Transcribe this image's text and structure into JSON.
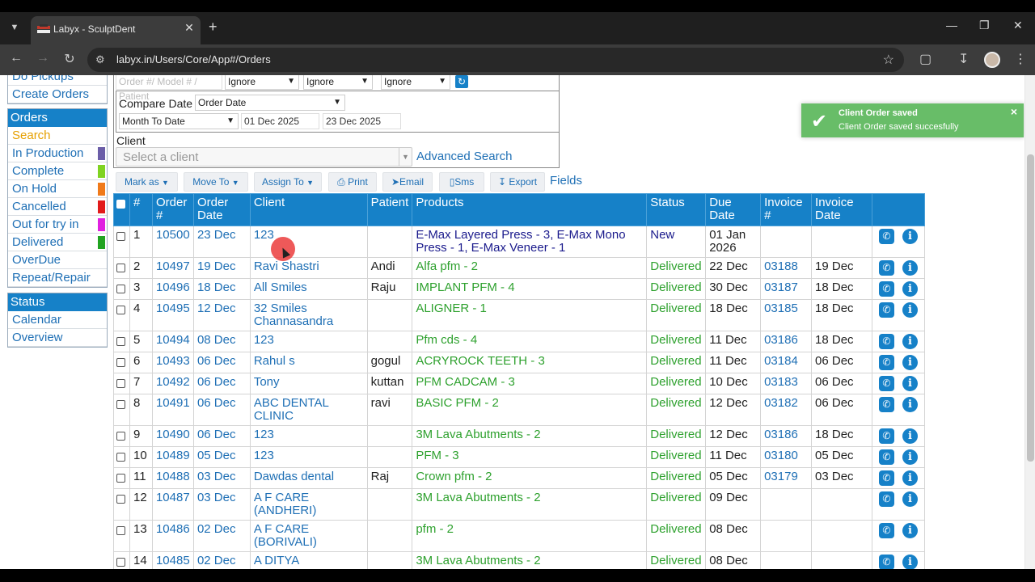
{
  "browser": {
    "tab_title": "Labyx - SculptDent",
    "url": "labyx.in/Users/Core/App#/Orders"
  },
  "menu": {
    "partial_top": "Do Pickups",
    "create_orders": "Create Orders",
    "orders_head": "Orders",
    "items": [
      {
        "label": "Search",
        "color": ""
      },
      {
        "label": "In Production",
        "color": "#6b5ea8"
      },
      {
        "label": "Complete",
        "color": "#7fd321"
      },
      {
        "label": "On Hold",
        "color": "#f07a1a"
      },
      {
        "label": "Cancelled",
        "color": "#e21b1b"
      },
      {
        "label": "Out for try in",
        "color": "#e020e0"
      },
      {
        "label": "Delivered",
        "color": "#21a321"
      },
      {
        "label": "OverDue",
        "color": ""
      },
      {
        "label": "Repeat/Repair",
        "color": ""
      }
    ],
    "status_head": "Status",
    "status_items": [
      "Calendar",
      "Overview"
    ]
  },
  "filters": {
    "search_placeholder": "Order #/ Model # / Patient",
    "ignore1": "Ignore",
    "ignore2": "Ignore",
    "ignore3": "Ignore",
    "compare_label": "Compare Date",
    "compare_value": "Order Date",
    "range_value": "Month To Date",
    "from_date": "01 Dec 2025",
    "to_date": "23 Dec 2025",
    "client_label": "Client",
    "client_placeholder": "Select a client",
    "advanced_search": "Advanced Search"
  },
  "actions": {
    "mark_as": "Mark as",
    "move_to": "Move To",
    "assign_to": "Assign To",
    "print": "Print",
    "email": "Email",
    "sms": "Sms",
    "export": "Export",
    "fields": "Fields"
  },
  "table": {
    "headers": [
      "#",
      "Order #",
      "Order Date",
      "Client",
      "Patient",
      "Products",
      "Status",
      "Due Date",
      "Invoice #",
      "Invoice Date"
    ],
    "rows": [
      {
        "n": "1",
        "order": "10500",
        "date": "23 Dec",
        "client": "123",
        "patient": "",
        "products": "E-Max Layered Press - 3, E-Max Mono Press - 1, E-Max Veneer - 1",
        "status": "New",
        "due": "01 Jan 2026",
        "invoice": "",
        "inv_date": ""
      },
      {
        "n": "2",
        "order": "10497",
        "date": "19 Dec",
        "client": "Ravi Shastri",
        "patient": "Andi",
        "products": "Alfa pfm - 2",
        "status": "Delivered",
        "due": "22 Dec",
        "invoice": "03188",
        "inv_date": "19 Dec"
      },
      {
        "n": "3",
        "order": "10496",
        "date": "18 Dec",
        "client": "All Smiles",
        "patient": "Raju",
        "products": "IMPLANT PFM - 4",
        "status": "Delivered",
        "due": "30 Dec",
        "invoice": "03187",
        "inv_date": "18 Dec"
      },
      {
        "n": "4",
        "order": "10495",
        "date": "12 Dec",
        "client": "32 Smiles Channasandra",
        "patient": "",
        "products": "ALIGNER - 1",
        "status": "Delivered",
        "due": "18 Dec",
        "invoice": "03185",
        "inv_date": "18 Dec"
      },
      {
        "n": "5",
        "order": "10494",
        "date": "08 Dec",
        "client": "123",
        "patient": "",
        "products": "Pfm cds - 4",
        "status": "Delivered",
        "due": "11 Dec",
        "invoice": "03186",
        "inv_date": "18 Dec"
      },
      {
        "n": "6",
        "order": "10493",
        "date": "06 Dec",
        "client": "Rahul s",
        "patient": "gogul",
        "products": "ACRYROCK TEETH - 3",
        "status": "Delivered",
        "due": "11 Dec",
        "invoice": "03184",
        "inv_date": "06 Dec"
      },
      {
        "n": "7",
        "order": "10492",
        "date": "06 Dec",
        "client": "Tony",
        "patient": "kuttan",
        "products": "PFM CADCAM - 3",
        "status": "Delivered",
        "due": "10 Dec",
        "invoice": "03183",
        "inv_date": "06 Dec"
      },
      {
        "n": "8",
        "order": "10491",
        "date": "06 Dec",
        "client": "ABC DENTAL CLINIC",
        "patient": "ravi",
        "products": "BASIC PFM - 2",
        "status": "Delivered",
        "due": "12 Dec",
        "invoice": "03182",
        "inv_date": "06 Dec"
      },
      {
        "n": "9",
        "order": "10490",
        "date": "06 Dec",
        "client": "123",
        "patient": "",
        "products": "3M Lava Abutments - 2",
        "status": "Delivered",
        "due": "12 Dec",
        "invoice": "03186",
        "inv_date": "18 Dec"
      },
      {
        "n": "10",
        "order": "10489",
        "date": "05 Dec",
        "client": "123",
        "patient": "",
        "products": "PFM - 3",
        "status": "Delivered",
        "due": "11 Dec",
        "invoice": "03180",
        "inv_date": "05 Dec"
      },
      {
        "n": "11",
        "order": "10488",
        "date": "03 Dec",
        "client": "Dawdas dental",
        "patient": "Raj",
        "products": "Crown pfm - 2",
        "status": "Delivered",
        "due": "05 Dec",
        "invoice": "03179",
        "inv_date": "03 Dec"
      },
      {
        "n": "12",
        "order": "10487",
        "date": "03 Dec",
        "client": "A F CARE (ANDHERI)",
        "patient": "",
        "products": "3M Lava Abutments - 2",
        "status": "Delivered",
        "due": "09 Dec",
        "invoice": "",
        "inv_date": ""
      },
      {
        "n": "13",
        "order": "10486",
        "date": "02 Dec",
        "client": "A F CARE (BORIVALI)",
        "patient": "",
        "products": "pfm - 2",
        "status": "Delivered",
        "due": "08 Dec",
        "invoice": "",
        "inv_date": ""
      },
      {
        "n": "14",
        "order": "10485",
        "date": "02 Dec",
        "client": "A DITYA",
        "patient": "",
        "products": "3M Lava Abutments - 2",
        "status": "Delivered",
        "due": "08 Dec",
        "invoice": "",
        "inv_date": ""
      }
    ]
  },
  "toast": {
    "title": "Client Order saved",
    "message": "Client Order saved succesfully"
  }
}
